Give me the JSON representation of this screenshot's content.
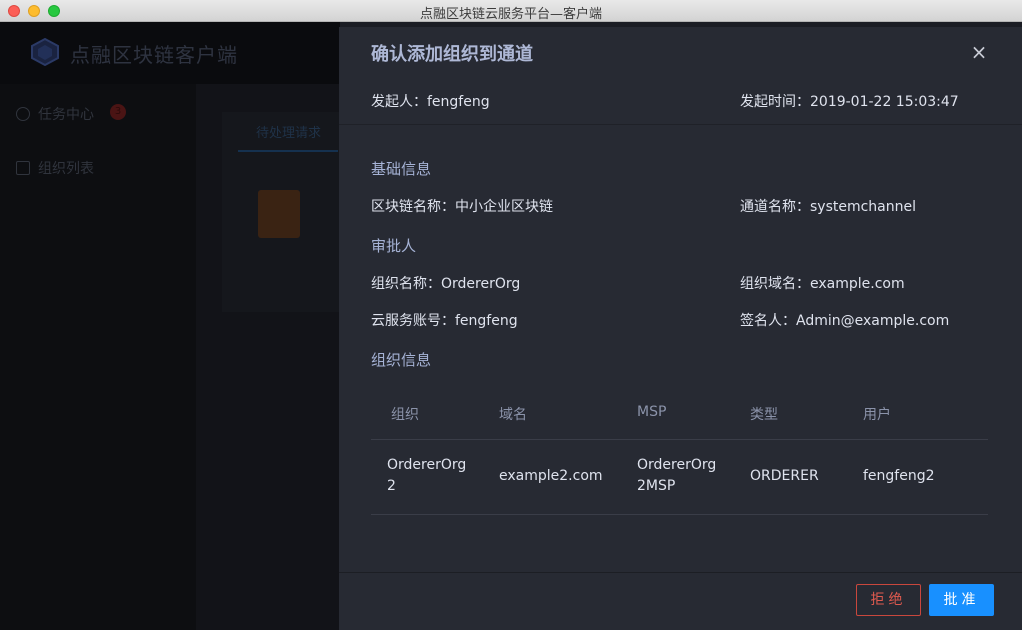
{
  "window": {
    "title": "点融区块链云服务平台—客户端"
  },
  "background": {
    "brand_name": "点融区块链客户端",
    "sidebar": [
      {
        "label": "任务中心",
        "badge": "3"
      },
      {
        "label": "组织列表"
      }
    ],
    "tab_label": "待处理请求"
  },
  "modal": {
    "title": "确认添加组织到通道",
    "close_icon": "×",
    "initiator_label": "发起人：",
    "initiator": "fengfeng",
    "time_label": "发起时间：",
    "time": "2019-01-22 15:03:47",
    "basic_section": "基础信息",
    "chain_label": "区块链名称：",
    "chain_name": "中小企业区块链",
    "channel_label": "通道名称：",
    "channel_name": "systemchannel",
    "approver_section": "审批人",
    "org_name_label": "组织名称：",
    "org_name": "OrdererOrg",
    "org_domain_label": "组织域名：",
    "org_domain": "example.com",
    "account_label": "云服务账号：",
    "account": "fengfeng",
    "signer_label": "签名人：",
    "signer": "Admin@example.com",
    "org_section": "组织信息",
    "table": {
      "headers": [
        "组织",
        "域名",
        "MSP",
        "类型",
        "用户"
      ],
      "rows": [
        {
          "org_line1": "OrdererOrg",
          "org_line2": "2",
          "domain": "example2.com",
          "msp_line1": "OrdererOrg",
          "msp_line2": "2MSP",
          "type": "ORDERER",
          "user": "fengfeng2"
        }
      ]
    },
    "reject_label": "拒绝",
    "approve_label": "批准"
  },
  "colors": {
    "accent": "#1890ff",
    "danger": "#e05a4f",
    "panel": "#272a33"
  }
}
